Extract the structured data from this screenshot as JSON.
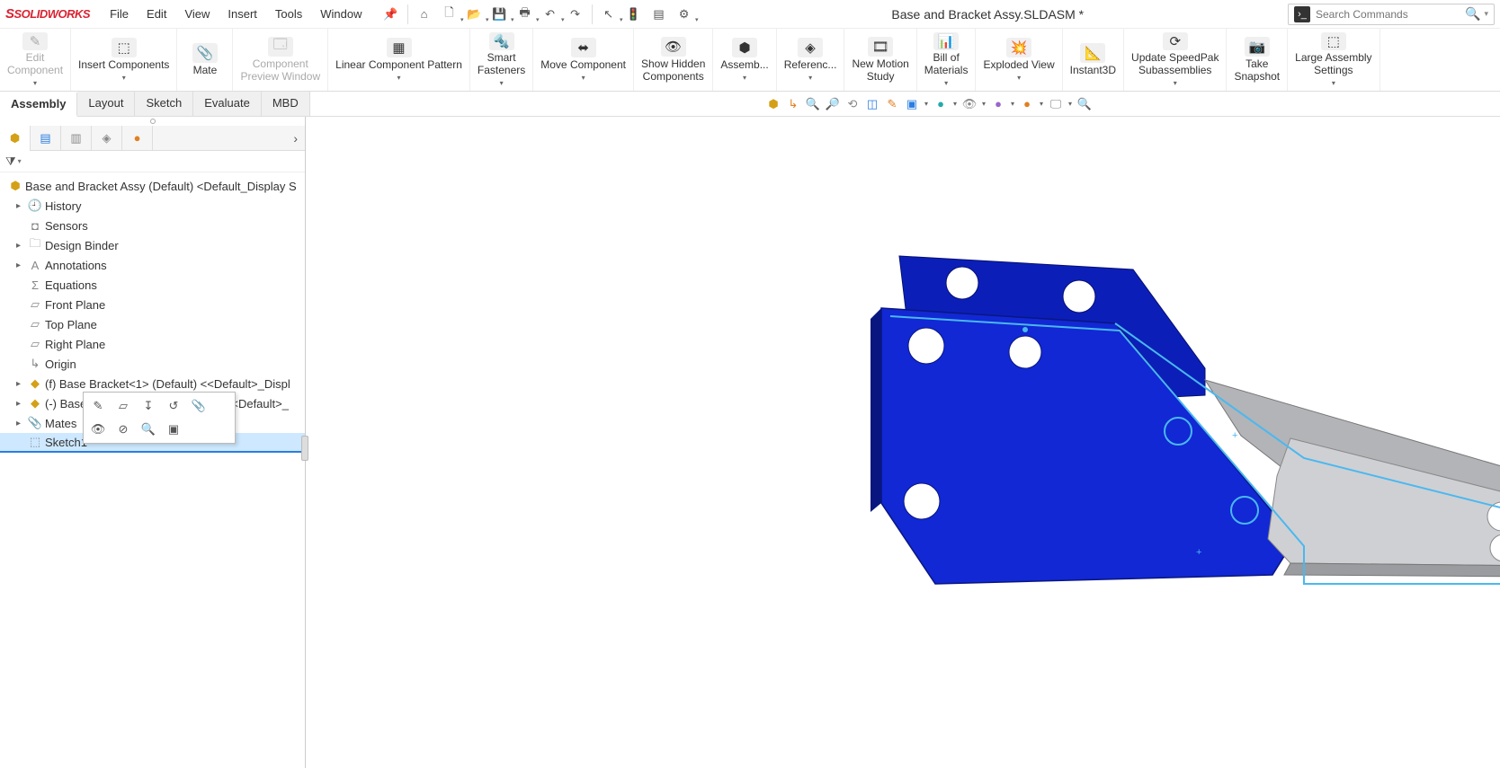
{
  "app": {
    "logo_prefix": "S",
    "logo_rest": "SOLIDWORKS",
    "title": "Base and Bracket Assy.SLDASM *",
    "search_placeholder": "Search Commands"
  },
  "menus": [
    "File",
    "Edit",
    "View",
    "Insert",
    "Tools",
    "Window"
  ],
  "quick_icons": [
    {
      "name": "pin-icon",
      "glyph": "📌"
    },
    {
      "name": "home-icon",
      "glyph": "⌂"
    },
    {
      "name": "new-icon",
      "glyph": "🗋",
      "dd": true
    },
    {
      "name": "open-icon",
      "glyph": "📂",
      "dd": true
    },
    {
      "name": "save-icon",
      "glyph": "💾",
      "dd": true
    },
    {
      "name": "print-icon",
      "glyph": "🖶",
      "dd": true
    },
    {
      "name": "undo-icon",
      "glyph": "↶",
      "dd": true
    },
    {
      "name": "redo-icon",
      "glyph": "↷"
    },
    {
      "name": "select-icon",
      "glyph": "↖",
      "dd": true
    },
    {
      "name": "traffic-icon",
      "glyph": "🚦"
    },
    {
      "name": "options-page-icon",
      "glyph": "▤"
    },
    {
      "name": "settings-icon",
      "glyph": "⚙",
      "dd": true
    }
  ],
  "ribbon": [
    {
      "name": "edit-component",
      "label": "Edit\nComponent",
      "glyph": "✎",
      "disabled": true,
      "dd": true
    },
    {
      "name": "insert-components",
      "label": "Insert Components",
      "glyph": "⬚",
      "dd": true
    },
    {
      "name": "mate",
      "label": "Mate",
      "glyph": "📎"
    },
    {
      "name": "component-preview",
      "label": "Component\nPreview Window",
      "glyph": "🗔",
      "disabled": true
    },
    {
      "name": "linear-pattern",
      "label": "Linear Component Pattern",
      "glyph": "▦",
      "dd": true
    },
    {
      "name": "smart-fasteners",
      "label": "Smart\nFasteners",
      "glyph": "🔩",
      "dd": true
    },
    {
      "name": "move-component",
      "label": "Move Component",
      "glyph": "⬌",
      "dd": true
    },
    {
      "name": "show-hidden",
      "label": "Show Hidden\nComponents",
      "glyph": "👁"
    },
    {
      "name": "assembly-features",
      "label": "Assemb...",
      "glyph": "⬢",
      "dd": true
    },
    {
      "name": "reference-geom",
      "label": "Referenc...",
      "glyph": "◈",
      "dd": true
    },
    {
      "name": "new-motion",
      "label": "New Motion\nStudy",
      "glyph": "🎞"
    },
    {
      "name": "bom",
      "label": "Bill of\nMaterials",
      "glyph": "📊",
      "dd": true
    },
    {
      "name": "exploded-view",
      "label": "Exploded View",
      "glyph": "💥",
      "dd": true
    },
    {
      "name": "instant3d",
      "label": "Instant3D",
      "glyph": "📐"
    },
    {
      "name": "speedpak",
      "label": "Update SpeedPak\nSubassemblies",
      "glyph": "⟳",
      "dd": true
    },
    {
      "name": "snapshot",
      "label": "Take\nSnapshot",
      "glyph": "📷"
    },
    {
      "name": "large-assembly",
      "label": "Large Assembly\nSettings",
      "glyph": "⬚",
      "dd": true
    }
  ],
  "tabs": [
    "Assembly",
    "Layout",
    "Sketch",
    "Evaluate",
    "MBD"
  ],
  "tabs_active": 0,
  "fm_tabs": [
    {
      "name": "feature-manager-icon",
      "glyph": "⬢",
      "color": "ic-yellow"
    },
    {
      "name": "property-manager-icon",
      "glyph": "▤",
      "color": "ic-blue"
    },
    {
      "name": "config-manager-icon",
      "glyph": "▥",
      "color": "ic-gray"
    },
    {
      "name": "dimxpert-icon",
      "glyph": "◈",
      "color": "ic-gray"
    },
    {
      "name": "display-manager-icon",
      "glyph": "●",
      "color": "ic-orange"
    }
  ],
  "tree": {
    "root": "Base and Bracket Assy (Default) <Default_Display S",
    "items": [
      {
        "name": "history",
        "label": "History",
        "glyph": "🕘",
        "exp": "▸",
        "color": "ic-gray"
      },
      {
        "name": "sensors",
        "label": "Sensors",
        "glyph": "◘",
        "color": "ic-gray"
      },
      {
        "name": "design-binder",
        "label": "Design Binder",
        "glyph": "🗀",
        "exp": "▸",
        "color": "ic-gray"
      },
      {
        "name": "annotations",
        "label": "Annotations",
        "glyph": "A",
        "exp": "▸",
        "color": "ic-gray"
      },
      {
        "name": "equations",
        "label": "Equations",
        "glyph": "Σ",
        "color": "ic-gray"
      },
      {
        "name": "front-plane",
        "label": "Front Plane",
        "glyph": "▱",
        "color": "ic-gray"
      },
      {
        "name": "top-plane",
        "label": "Top Plane",
        "glyph": "▱",
        "color": "ic-gray"
      },
      {
        "name": "right-plane",
        "label": "Right Plane",
        "glyph": "▱",
        "color": "ic-gray"
      },
      {
        "name": "origin",
        "label": "Origin",
        "glyph": "↳",
        "color": "ic-gray"
      },
      {
        "name": "part1",
        "label": "(f) Base Bracket<1> (Default) <<Default>_Displ",
        "glyph": "◆",
        "exp": "▸",
        "color": "ic-yellow"
      },
      {
        "name": "part2",
        "label": "(-) Base Bracket 2<2> -> (Default) <<Default>_",
        "glyph": "◆",
        "exp": "▸",
        "color": "ic-yellow"
      },
      {
        "name": "mates",
        "label": "Mates",
        "glyph": "📎",
        "exp": "▸",
        "color": "ic-blue"
      },
      {
        "name": "sketch1",
        "label": "Sketch1",
        "glyph": "⬚",
        "selected": true,
        "color": "ic-gray"
      }
    ]
  },
  "context_icons": [
    {
      "name": "edit-sketch-icon",
      "glyph": "✎"
    },
    {
      "name": "edit-sketch-plane-icon",
      "glyph": "▱"
    },
    {
      "name": "normal-to-icon",
      "glyph": "↧"
    },
    {
      "name": "rollbar-icon",
      "glyph": "↺"
    },
    {
      "name": "attach-icon",
      "glyph": "📎"
    },
    {
      "name": "hide-icon",
      "glyph": "👁"
    },
    {
      "name": "suppress-icon",
      "glyph": "⊘"
    },
    {
      "name": "zoom-to-icon",
      "glyph": "🔍"
    },
    {
      "name": "isolate-icon",
      "glyph": "▣"
    }
  ],
  "headsup": [
    {
      "name": "view-orient-icon",
      "glyph": "⬢",
      "color": "ic-yellow"
    },
    {
      "name": "triad-icon",
      "glyph": "↳",
      "color": "ic-orange"
    },
    {
      "name": "zoom-fit-icon",
      "glyph": "🔍",
      "color": "ic-gray"
    },
    {
      "name": "zoom-area-icon",
      "glyph": "🔎",
      "color": "ic-gray"
    },
    {
      "name": "prev-view-icon",
      "glyph": "⟲",
      "color": "ic-gray"
    },
    {
      "name": "section-icon",
      "glyph": "◫",
      "color": "ic-blue"
    },
    {
      "name": "dynamic-icon",
      "glyph": "✎",
      "color": "ic-orange"
    },
    {
      "name": "display-style-icon",
      "glyph": "▣",
      "color": "ic-blue",
      "dd": true
    },
    {
      "name": "hide-show-icon",
      "glyph": "●",
      "color": "ic-teal",
      "dd": true
    },
    {
      "name": "eye-icon",
      "glyph": "👁",
      "color": "ic-gray",
      "dd": true
    },
    {
      "name": "edit-appearance-icon",
      "glyph": "●",
      "color": "ic-purple",
      "dd": true
    },
    {
      "name": "apply-scene-icon",
      "glyph": "●",
      "color": "ic-orange",
      "dd": true
    },
    {
      "name": "view-settings-icon",
      "glyph": "🖵",
      "color": "ic-gray",
      "dd": true
    },
    {
      "name": "render-icon",
      "glyph": "🔍",
      "color": "ic-red"
    }
  ]
}
